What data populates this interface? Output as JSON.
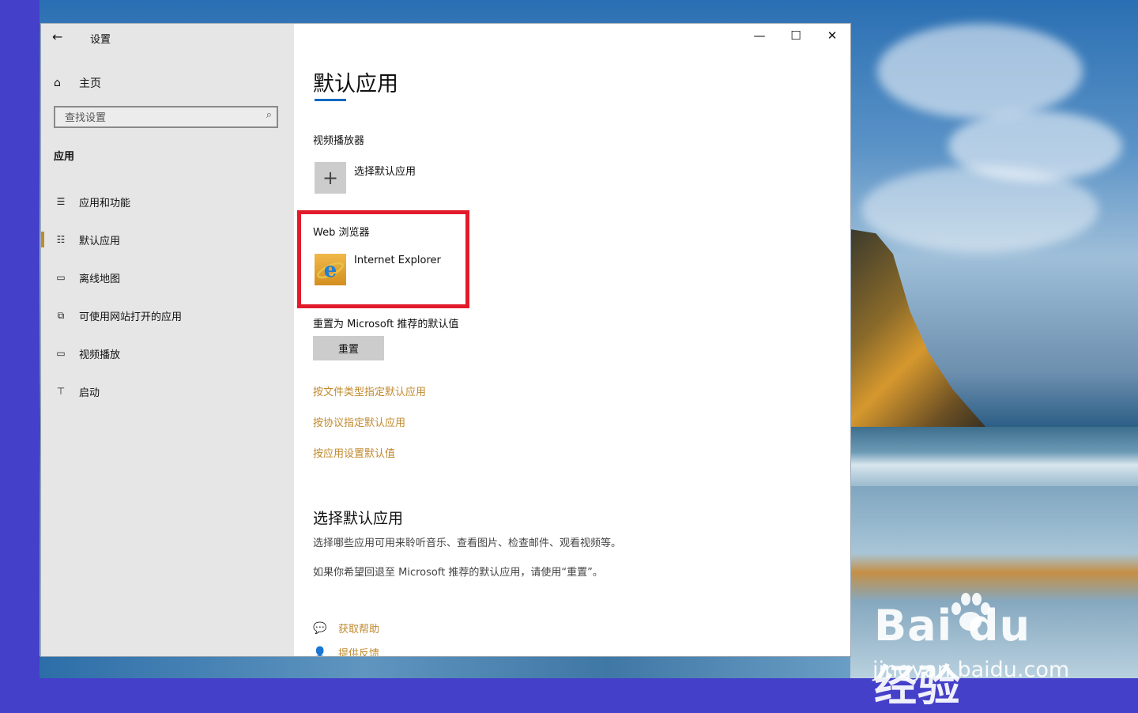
{
  "window": {
    "title": "设置",
    "controls": {
      "minimize": "—",
      "maximize": "☐",
      "close": "✕"
    }
  },
  "sidebar": {
    "back_icon": "←",
    "home": {
      "icon": "⌂",
      "label": "主页"
    },
    "search": {
      "placeholder": "查找设置",
      "icon": "⌕"
    },
    "section_title": "应用",
    "items": [
      {
        "icon": "☰",
        "label": "应用和功能",
        "active": false
      },
      {
        "icon": "☷",
        "label": "默认应用",
        "active": true
      },
      {
        "icon": "▭",
        "label": "离线地图",
        "active": false
      },
      {
        "icon": "⧉",
        "label": "可使用网站打开的应用",
        "active": false
      },
      {
        "icon": "▭",
        "label": "视频播放",
        "active": false
      },
      {
        "icon": "⊤",
        "label": "启动",
        "active": false
      }
    ]
  },
  "main": {
    "page_title": "默认应用",
    "video_player": {
      "heading": "视频播放器",
      "app_icon": "+",
      "app_name": "选择默认应用"
    },
    "web_browser": {
      "heading": "Web 浏览器",
      "app_name": "Internet Explorer"
    },
    "reset": {
      "label": "重置为 Microsoft 推荐的默认值",
      "button": "重置"
    },
    "links": [
      "按文件类型指定默认应用",
      "按协议指定默认应用",
      "按应用设置默认值"
    ],
    "choose_section": {
      "title": "选择默认应用",
      "desc1": "选择哪些应用可用来聆听音乐、查看图片、检查邮件、观看视频等。",
      "desc2": "如果你希望回退至 Microsoft 推荐的默认应用，请使用“重置”。"
    },
    "help": {
      "get_help": "获取帮助",
      "feedback": "提供反馈"
    }
  },
  "watermark": {
    "logo": "Bai  du 经验",
    "url": "jingyan.baidu.com"
  },
  "colors": {
    "accent": "#c08a2e",
    "title_underline": "#0067c0",
    "highlight": "#e21b2b"
  }
}
